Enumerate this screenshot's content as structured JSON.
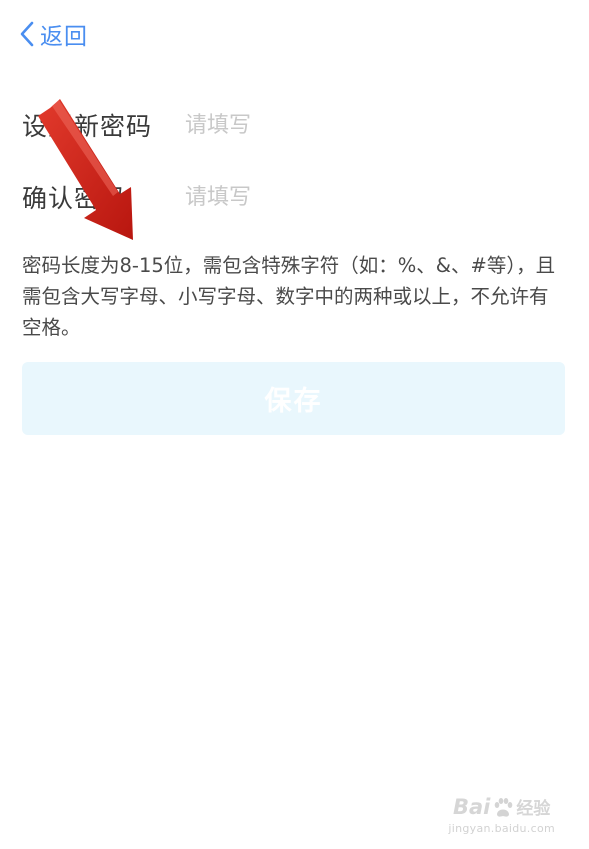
{
  "nav": {
    "back_label": "返回",
    "back_icon": "chevron-left-icon",
    "accent_color": "#4a8ef0"
  },
  "form": {
    "new_password": {
      "label": "设置新密码",
      "value": "",
      "placeholder": "请填写"
    },
    "confirm_password": {
      "label": "确认密码",
      "value": "",
      "placeholder": "请填写"
    },
    "hint": "密码长度为8-15位，需包含特殊字符（如：%、&、#等），且需包含大写字母、小写字母、数字中的两种或以上，不允许有空格。"
  },
  "actions": {
    "save_label": "保存",
    "save_state": "disabled",
    "save_bg_color": "#e9f7fd"
  },
  "annotation": {
    "type": "red-arrow",
    "color": "#d62a1e",
    "points_to": "confirm-password-label"
  },
  "watermark": {
    "brand_pre": "Bai",
    "brand_post": "经验",
    "icon": "paw-icon",
    "url": "jingyan.baidu.com"
  }
}
